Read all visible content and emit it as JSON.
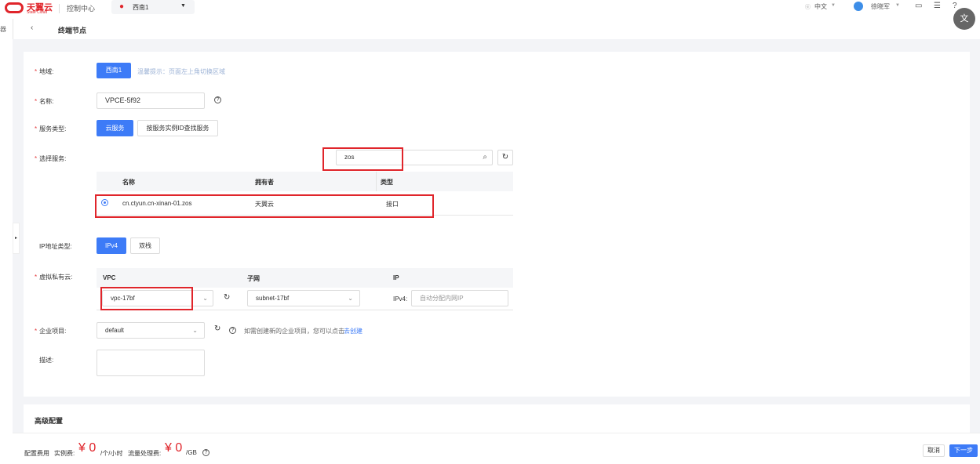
{
  "header": {
    "logo_cn": "天翼云",
    "logo_en": "State Cloud",
    "console": "控制中心",
    "region": "西南1",
    "lang": "中文",
    "user": "徐晓军"
  },
  "sub": {
    "title": "终端节点",
    "left_label": "器"
  },
  "form": {
    "region_label": "地域:",
    "region_value": "西南1",
    "region_tip": "温馨提示：页面左上角切换区域",
    "name_label": "名称:",
    "name_value": "VPCE-5f92",
    "service_type_label": "服务类型:",
    "service_type_options": [
      "云服务",
      "按服务实例ID查找服务"
    ],
    "select_service_label": "选择服务:",
    "search_value": "zos",
    "table": {
      "headers": [
        "名称",
        "拥有者",
        "类型"
      ],
      "rows": [
        {
          "name": "cn.ctyun.cn-xinan-01.zos",
          "owner": "天翼云",
          "type": "接口"
        }
      ]
    },
    "ip_type_label": "IP地址类型:",
    "ip_type_options": [
      "IPv4",
      "双栈"
    ],
    "vpc_label": "虚拟私有云:",
    "vpc_headers": [
      "VPC",
      "子网",
      "IP"
    ],
    "vpc_value": "vpc-17bf",
    "subnet_value": "subnet-17bf",
    "ipv4_label": "IPv4:",
    "ip_placeholder": "自动分配内网IP",
    "project_label": "企业项目:",
    "project_value": "default",
    "project_tip": "如需创建新的企业项目，您可以点击",
    "project_link": "去创建",
    "desc_label": "描述:"
  },
  "advanced": {
    "title": "高级配置"
  },
  "footer": {
    "cost_label": "配置费用",
    "instance_label": "实例费:",
    "instance_price": "¥ 0",
    "instance_unit": "/个/小时",
    "traffic_label": "流量处理费:",
    "traffic_price": "¥ 0",
    "traffic_unit": "/GB",
    "cancel": "取消",
    "next": "下一步"
  }
}
